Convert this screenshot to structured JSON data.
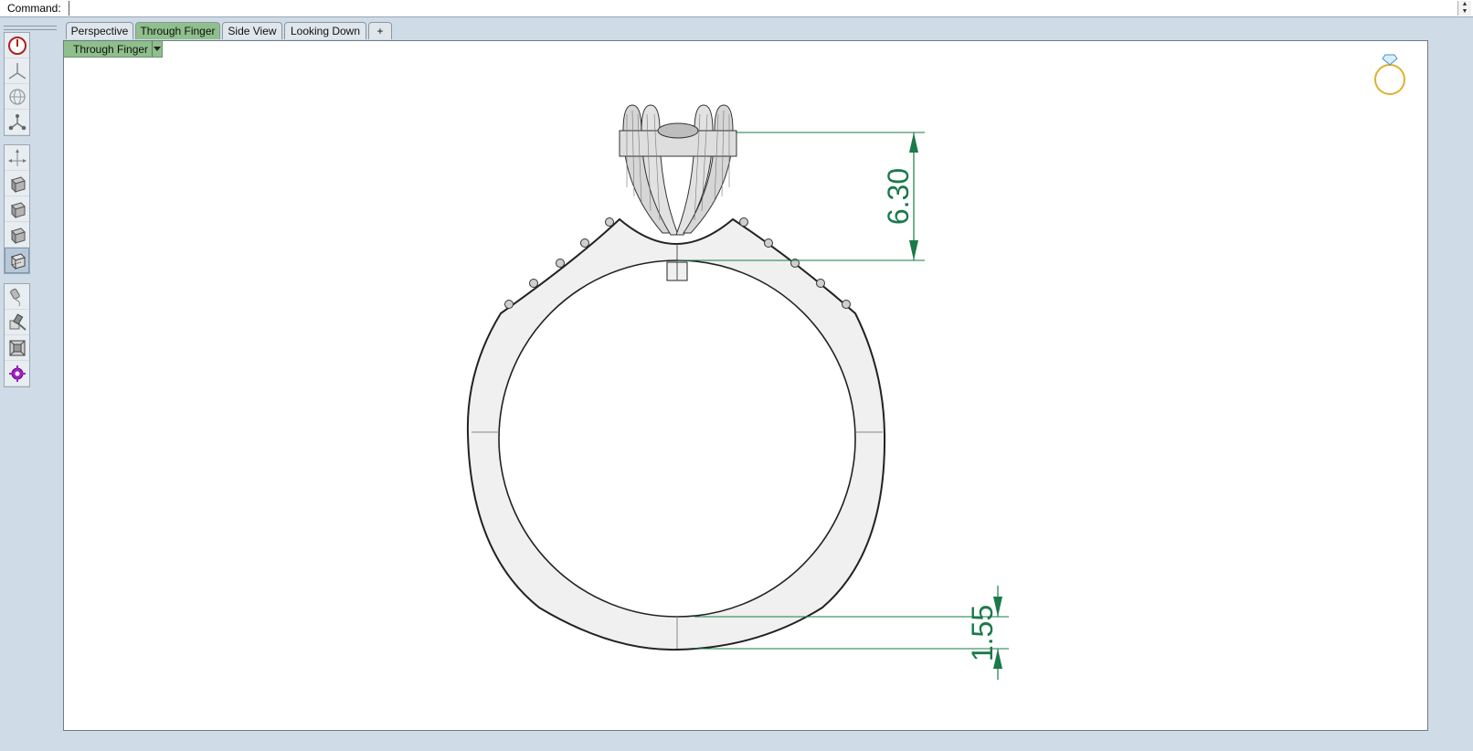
{
  "command_bar": {
    "label": "Command:",
    "value": ""
  },
  "left_toolbar": {
    "groups": [
      [
        "power-icon",
        "axes-star-icon",
        "globe-icon",
        "node-branch-icon"
      ],
      [
        "move-arrows-icon",
        "box-view-icon",
        "box-view-icon-2",
        "box-view-icon-3",
        "box-wireframe-icon"
      ],
      [
        "brush-icon",
        "paint-tools-icon",
        "zoom-extents-icon",
        "purple-gear-icon"
      ]
    ],
    "active_tool": "box-wireframe-icon"
  },
  "tabs": [
    {
      "label": "Perspective",
      "active": false
    },
    {
      "label": "Through Finger",
      "active": true
    },
    {
      "label": "Side View",
      "active": false
    },
    {
      "label": "Looking Down",
      "active": false
    }
  ],
  "add_tab_symbol": "+",
  "viewport": {
    "title": "Through Finger",
    "dimension_top": "6.30",
    "dimension_bottom": "1.55",
    "dimension_color": "#1a7a4a",
    "logo": "ring-logo-icon"
  }
}
